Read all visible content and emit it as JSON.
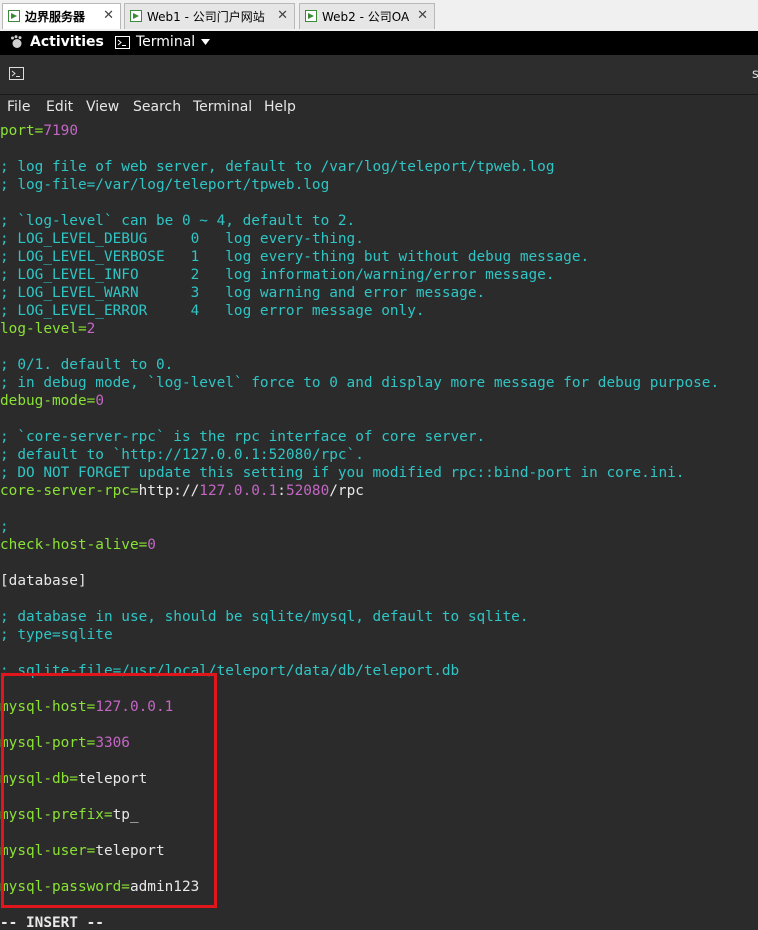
{
  "browser_tabs": [
    {
      "label": "边界服务器",
      "active": true
    },
    {
      "label": "Web1 - 公司门户网站",
      "active": false
    },
    {
      "label": "Web2 - 公司OA",
      "active": false
    }
  ],
  "tab_close_glyph": "✕",
  "topbar": {
    "activities": "Activities",
    "app_menu": "Terminal"
  },
  "titlebar": {
    "title_fragment": "s"
  },
  "menu": [
    "File",
    "Edit",
    "View",
    "Search",
    "Terminal",
    "Help"
  ],
  "colors": {
    "comment": "#2fc5c5",
    "key": "#8ae234",
    "value": "#c466c4",
    "text": "#e8e8e8",
    "highlight_box": "#e0161d"
  },
  "lines": [
    {
      "parts": [
        {
          "t": "port=",
          "c": "k"
        },
        {
          "t": "7190",
          "c": "v"
        }
      ]
    },
    {
      "parts": []
    },
    {
      "parts": [
        {
          "t": "; log file of web server, default to /var/log/teleport/tpweb.log",
          "c": "c"
        }
      ]
    },
    {
      "parts": [
        {
          "t": "; log-file=/var/log/teleport/tpweb.log",
          "c": "c"
        }
      ]
    },
    {
      "parts": []
    },
    {
      "parts": [
        {
          "t": "; `log-level` can be 0 ~ 4, default to 2.",
          "c": "c"
        }
      ]
    },
    {
      "parts": [
        {
          "t": "; LOG_LEVEL_DEBUG     0   log every-thing.",
          "c": "c"
        }
      ]
    },
    {
      "parts": [
        {
          "t": "; LOG_LEVEL_VERBOSE   1   log every-thing but without debug message.",
          "c": "c"
        }
      ]
    },
    {
      "parts": [
        {
          "t": "; LOG_LEVEL_INFO      2   log information/warning/error message.",
          "c": "c"
        }
      ]
    },
    {
      "parts": [
        {
          "t": "; LOG_LEVEL_WARN      3   log warning and error message.",
          "c": "c"
        }
      ]
    },
    {
      "parts": [
        {
          "t": "; LOG_LEVEL_ERROR     4   log error message only.",
          "c": "c"
        }
      ]
    },
    {
      "parts": [
        {
          "t": "log-level=",
          "c": "k"
        },
        {
          "t": "2",
          "c": "v"
        }
      ]
    },
    {
      "parts": []
    },
    {
      "parts": [
        {
          "t": "; 0/1. default to 0.",
          "c": "c"
        }
      ]
    },
    {
      "parts": [
        {
          "t": "; in debug mode, `log-level` force to 0 and display more message for debug purpose.",
          "c": "c"
        }
      ]
    },
    {
      "parts": [
        {
          "t": "debug-mode=",
          "c": "k"
        },
        {
          "t": "0",
          "c": "v"
        }
      ]
    },
    {
      "parts": []
    },
    {
      "parts": [
        {
          "t": "; `core-server-rpc` is the rpc interface of core server.",
          "c": "c"
        }
      ]
    },
    {
      "parts": [
        {
          "t": "; default to `http://127.0.0.1:52080/rpc`.",
          "c": "c"
        }
      ]
    },
    {
      "parts": [
        {
          "t": "; DO NOT FORGET update this setting if you modified rpc::bind-port in core.ini.",
          "c": "c"
        }
      ]
    },
    {
      "parts": [
        {
          "t": "core-server-rpc=",
          "c": "k"
        },
        {
          "t": "http://",
          "c": "w"
        },
        {
          "t": "127.0.0.1",
          "c": "v"
        },
        {
          "t": ":",
          "c": "w"
        },
        {
          "t": "52080",
          "c": "v"
        },
        {
          "t": "/rpc",
          "c": "w"
        }
      ]
    },
    {
      "parts": []
    },
    {
      "parts": [
        {
          "t": ";",
          "c": "c"
        }
      ]
    },
    {
      "parts": [
        {
          "t": "check-host-alive=",
          "c": "k"
        },
        {
          "t": "0",
          "c": "v"
        }
      ]
    },
    {
      "parts": []
    },
    {
      "parts": [
        {
          "t": "[database]",
          "c": "w"
        }
      ]
    },
    {
      "parts": []
    },
    {
      "parts": [
        {
          "t": "; database in use, should be sqlite/mysql, default to sqlite.",
          "c": "c"
        }
      ]
    },
    {
      "parts": [
        {
          "t": "; type=sqlite",
          "c": "c"
        }
      ]
    },
    {
      "parts": []
    },
    {
      "parts": [
        {
          "t": "; sqlite-file=/usr/local/teleport/data/db/teleport.db",
          "c": "c"
        }
      ]
    },
    {
      "parts": []
    },
    {
      "parts": [
        {
          "t": "mysql-host=",
          "c": "k"
        },
        {
          "t": "127.0.0.1",
          "c": "v"
        }
      ]
    },
    {
      "parts": []
    },
    {
      "parts": [
        {
          "t": "mysql-port=",
          "c": "k"
        },
        {
          "t": "3306",
          "c": "v"
        }
      ]
    },
    {
      "parts": []
    },
    {
      "parts": [
        {
          "t": "mysql-db=",
          "c": "k"
        },
        {
          "t": "teleport",
          "c": "w"
        }
      ]
    },
    {
      "parts": []
    },
    {
      "parts": [
        {
          "t": "mysql-prefix=",
          "c": "k"
        },
        {
          "t": "tp_",
          "c": "w"
        }
      ]
    },
    {
      "parts": []
    },
    {
      "parts": [
        {
          "t": "mysql-user=",
          "c": "k"
        },
        {
          "t": "teleport",
          "c": "w"
        }
      ]
    },
    {
      "parts": []
    },
    {
      "parts": [
        {
          "t": "mysql-password=",
          "c": "k"
        },
        {
          "t": "admin123",
          "c": "w"
        }
      ]
    },
    {
      "parts": []
    },
    {
      "parts": [
        {
          "t": "-- INSERT --",
          "c": "w",
          "bold": true
        }
      ]
    }
  ]
}
